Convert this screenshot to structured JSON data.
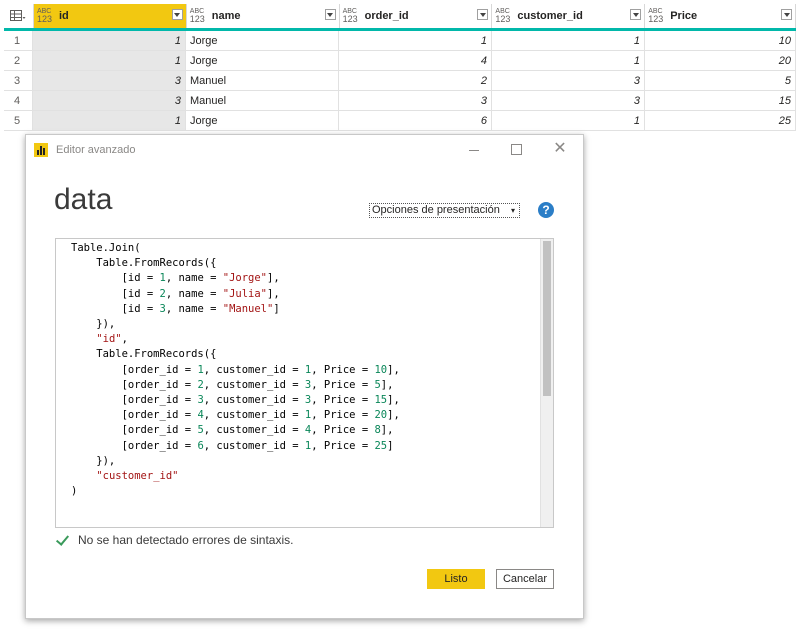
{
  "grid": {
    "columns": [
      {
        "name": "id",
        "type_top": "ABC",
        "type_bottom": "123",
        "selected": true
      },
      {
        "name": "name",
        "type_top": "ABC",
        "type_bottom": "123",
        "selected": false
      },
      {
        "name": "order_id",
        "type_top": "ABC",
        "type_bottom": "123",
        "selected": false
      },
      {
        "name": "customer_id",
        "type_top": "ABC",
        "type_bottom": "123",
        "selected": false
      },
      {
        "name": "Price",
        "type_top": "ABC",
        "type_bottom": "123",
        "selected": false
      }
    ],
    "rows": [
      {
        "num": "1",
        "id": "1",
        "name": "Jorge",
        "order_id": "1",
        "customer_id": "1",
        "price": "10"
      },
      {
        "num": "2",
        "id": "1",
        "name": "Jorge",
        "order_id": "4",
        "customer_id": "1",
        "price": "20"
      },
      {
        "num": "3",
        "id": "3",
        "name": "Manuel",
        "order_id": "2",
        "customer_id": "3",
        "price": "5"
      },
      {
        "num": "4",
        "id": "3",
        "name": "Manuel",
        "order_id": "3",
        "customer_id": "3",
        "price": "15"
      },
      {
        "num": "5",
        "id": "1",
        "name": "Jorge",
        "order_id": "6",
        "customer_id": "1",
        "price": "25"
      }
    ]
  },
  "dialog": {
    "title": "Editor avanzado",
    "query_name": "data",
    "display_options_label": "Opciones de presentación",
    "help_label": "?",
    "code_lines": [
      "Table.Join(",
      "    Table.FromRecords({",
      "        [id = 1, name = \"Jorge\"],",
      "        [id = 2, name = \"Julia\"],",
      "        [id = 3, name = \"Manuel\"]",
      "    }),",
      "    \"id\",",
      "    Table.FromRecords({",
      "        [order_id = 1, customer_id = 1, Price = 10],",
      "        [order_id = 2, customer_id = 3, Price = 5],",
      "        [order_id = 3, customer_id = 3, Price = 15],",
      "        [order_id = 4, customer_id = 1, Price = 20],",
      "        [order_id = 5, customer_id = 4, Price = 8],",
      "        [order_id = 6, customer_id = 1, Price = 25]",
      "    }),",
      "    \"customer_id\"",
      ")"
    ],
    "status_text": "No se han detectado errores de sintaxis.",
    "ok_label": "Listo",
    "cancel_label": "Cancelar"
  },
  "colors": {
    "accent_yellow": "#f2c811",
    "header_underline": "#01b8aa",
    "success_green": "#3a9a5b",
    "help_blue": "#2b7ec7"
  }
}
